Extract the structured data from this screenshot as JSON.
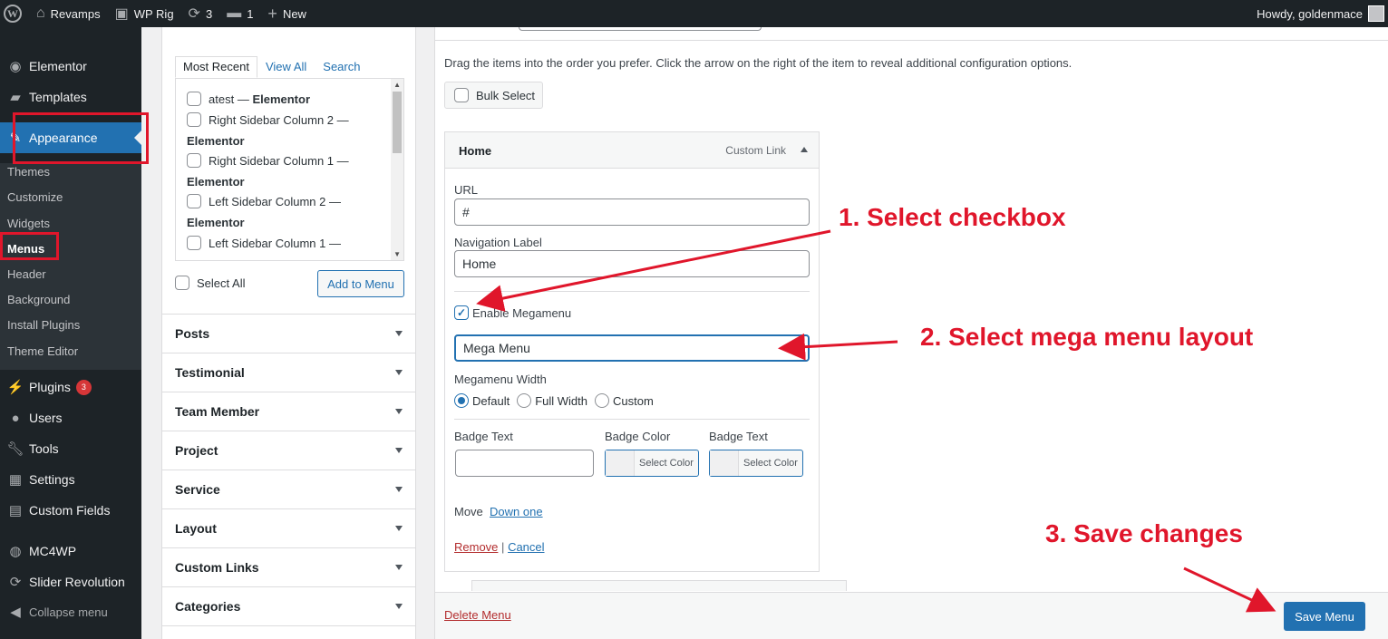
{
  "adminbar": {
    "site_name": "Revamps",
    "theme_name": "WP Rig",
    "updates_count": "3",
    "comments_count": "1",
    "new_label": "New",
    "howdy": "Howdy, goldenmace"
  },
  "sidebar": {
    "elementor": "Elementor",
    "templates": "Templates",
    "appearance": "Appearance",
    "submenu": [
      "Themes",
      "Customize",
      "Widgets",
      "Menus",
      "Header",
      "Background",
      "Install Plugins",
      "Theme Editor"
    ],
    "plugins": "Plugins",
    "plugins_badge": "3",
    "users": "Users",
    "tools": "Tools",
    "settings": "Settings",
    "custom_fields": "Custom Fields",
    "mc4wp": "MC4WP",
    "slider_revolution": "Slider Revolution",
    "collapse": "Collapse menu"
  },
  "add_items": {
    "tabs": [
      "Most Recent",
      "View All",
      "Search"
    ],
    "items": [
      {
        "title": "atest",
        "type": "Elementor"
      },
      {
        "title": "Right Sidebar Column 2",
        "type": "Elementor"
      },
      {
        "title": "Right Sidebar Column 1",
        "type": "Elementor"
      },
      {
        "title": "Left Sidebar Column 2",
        "type": "Elementor"
      },
      {
        "title": "Left Sidebar Column 1",
        "type": ""
      }
    ],
    "dash": "—",
    "select_all": "Select All",
    "add_to_menu": "Add to Menu",
    "sections": [
      "Posts",
      "Testimonial",
      "Team Member",
      "Project",
      "Service",
      "Layout",
      "Custom Links",
      "Categories"
    ]
  },
  "editor": {
    "instructions": "Drag the items into the order you prefer. Click the arrow on the right of the item to reveal additional configuration options.",
    "bulk_select": "Bulk Select",
    "item": {
      "title": "Home",
      "type": "Custom Link",
      "url_label": "URL",
      "url_value": "#",
      "nav_label": "Navigation Label",
      "nav_value": "Home",
      "enable_megamenu": "Enable Megamenu",
      "layout_value": "Mega Menu",
      "width_label": "Megamenu Width",
      "width_options": [
        "Default",
        "Full Width",
        "Custom"
      ],
      "badge_text_label": "Badge Text",
      "badge_color_label": "Badge Color",
      "badge_text2_label": "Badge Text",
      "select_color": "Select Color",
      "move_label": "Move",
      "move_link": "Down one",
      "remove": "Remove",
      "separator": "|",
      "cancel": "Cancel"
    },
    "delete_menu": "Delete Menu",
    "save_menu": "Save Menu"
  },
  "annotations": {
    "step1": "1. Select checkbox",
    "step2": "2. Select mega menu layout",
    "step3": "3. Save changes"
  },
  "colors": {
    "accent": "#2271b1",
    "sidebar_bg": "#1d2327",
    "annotation": "#e0162b"
  }
}
